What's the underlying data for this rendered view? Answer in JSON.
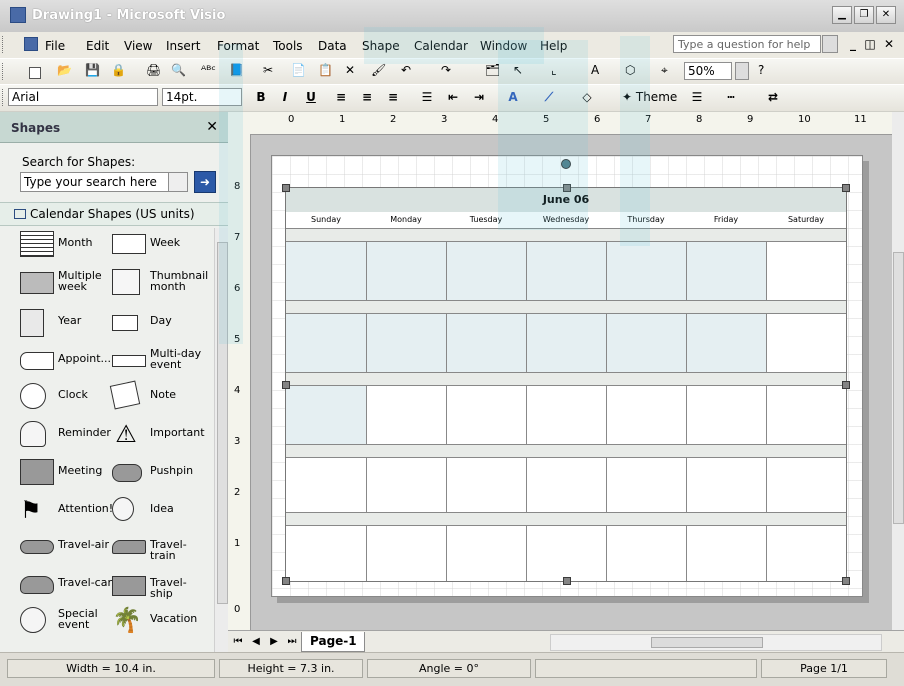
{
  "window": {
    "title": "Drawing1 - Microsoft Visio",
    "controls": [
      "minimize",
      "restore",
      "close"
    ]
  },
  "menu": {
    "items": [
      "File",
      "Edit",
      "View",
      "Insert",
      "Format",
      "Tools",
      "Data",
      "Shape",
      "Calendar",
      "Window",
      "Help"
    ],
    "help_placeholder": "Type a question for help"
  },
  "toolbar": {
    "zoom": "50%",
    "font": "Arial",
    "font_size": "14pt.",
    "theme_label": "Theme"
  },
  "shapes_panel": {
    "title": "Shapes",
    "search_label": "Search for Shapes:",
    "search_placeholder": "Type your search here",
    "stencil": "Calendar Shapes (US units)",
    "items": [
      {
        "label": "Month",
        "icon": "month-calendar-icon"
      },
      {
        "label": "Week",
        "icon": "week-calendar-icon"
      },
      {
        "label": "Multiple\nweek",
        "icon": "multiple-week-icon"
      },
      {
        "label": "Thumbnail\nmonth",
        "icon": "thumbnail-month-icon"
      },
      {
        "label": "Year",
        "icon": "year-calendar-icon"
      },
      {
        "label": "Day",
        "icon": "day-calendar-icon"
      },
      {
        "label": "Appoint...",
        "icon": "appointment-icon"
      },
      {
        "label": "Multi-day\nevent",
        "icon": "multi-day-event-icon"
      },
      {
        "label": "Clock",
        "icon": "clock-icon"
      },
      {
        "label": "Note",
        "icon": "note-icon"
      },
      {
        "label": "Reminder",
        "icon": "reminder-bell-icon"
      },
      {
        "label": "Important",
        "icon": "important-warning-icon"
      },
      {
        "label": "Meeting",
        "icon": "meeting-icon"
      },
      {
        "label": "Pushpin",
        "icon": "pushpin-icon"
      },
      {
        "label": "Attention!",
        "icon": "attention-flag-icon"
      },
      {
        "label": "Idea",
        "icon": "idea-lightbulb-icon"
      },
      {
        "label": "Travel-air",
        "icon": "travel-air-icon"
      },
      {
        "label": "Travel-train",
        "icon": "travel-train-icon"
      },
      {
        "label": "Travel-car",
        "icon": "travel-car-icon"
      },
      {
        "label": "Travel-ship",
        "icon": "travel-ship-icon"
      },
      {
        "label": "Special\nevent",
        "icon": "special-event-icon"
      },
      {
        "label": "Vacation",
        "icon": "vacation-icon"
      }
    ]
  },
  "calendar": {
    "title": "June 06",
    "days": [
      "Sunday",
      "Monday",
      "Tuesday",
      "Wednesday",
      "Thursday",
      "Friday",
      "Saturday"
    ]
  },
  "ruler": {
    "horizontal": [
      "0",
      "1",
      "2",
      "3",
      "4",
      "5",
      "6",
      "7",
      "8",
      "9",
      "10",
      "11"
    ],
    "vertical": [
      "8",
      "7",
      "6",
      "5",
      "4",
      "3",
      "2",
      "1",
      "0"
    ]
  },
  "tabs": {
    "page": "Page-1"
  },
  "status": {
    "width": "Width = 10.4 in.",
    "height": "Height = 7.3 in.",
    "angle": "Angle = 0°",
    "page": "Page 1/1"
  }
}
